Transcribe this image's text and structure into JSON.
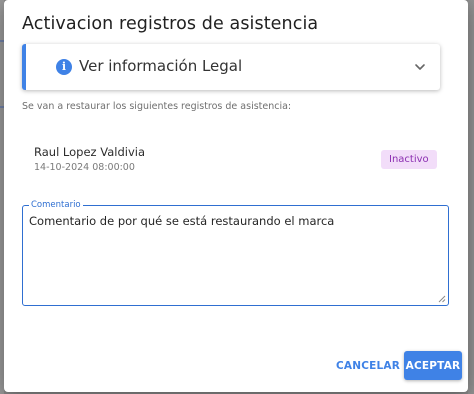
{
  "dialog": {
    "title": "Activacion registros de asistencia",
    "legal": {
      "label": "Ver información Legal",
      "icon": "info-icon",
      "expand_icon": "chevron-down-icon",
      "accent_color": "#3f82e6"
    },
    "intro_text": "Se van a restaurar los siguientes registros de asistencia:",
    "records": [
      {
        "name": "Raul Lopez Valdivia",
        "date": "14-10-2024 08:00:00",
        "status": "Inactivo",
        "status_color": "#8b2fb1",
        "status_background": "#f2ddf9"
      }
    ],
    "comment": {
      "label": "Comentario",
      "value": "Comentario de por qué se está restaurando el marca"
    },
    "actions": {
      "cancel_label": "CANCELAR",
      "accept_label": "ACEPTAR"
    }
  }
}
